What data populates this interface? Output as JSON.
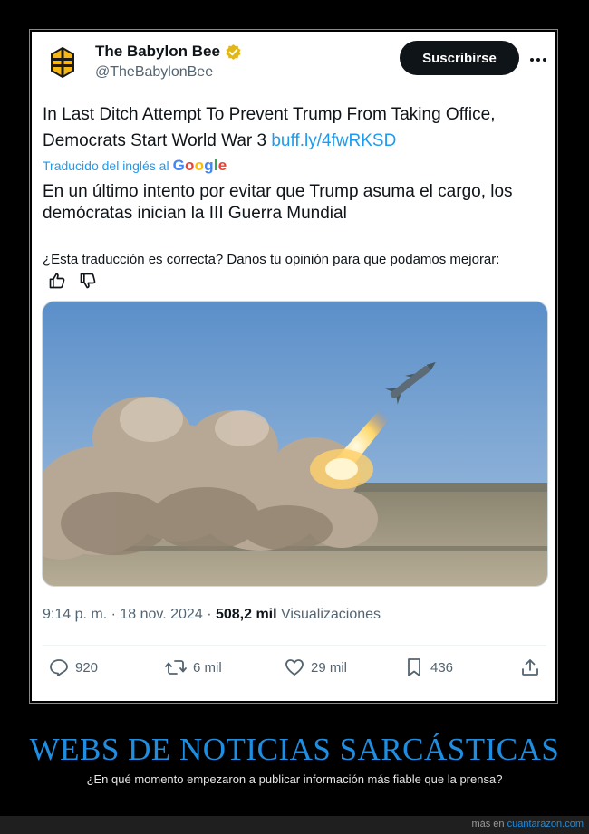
{
  "account": {
    "name": "The Babylon Bee",
    "handle": "@TheBabylonBee",
    "verified_icon": "verified-badge-gold",
    "avatar_icon": "bee-logo"
  },
  "header": {
    "subscribe_label": "Suscribirse",
    "more_icon": "more-dots"
  },
  "tweet": {
    "text": "In Last Ditch Attempt To Prevent Trump From Taking Office, Democrats Start World War 3",
    "link": "buff.ly/4fwRKSD",
    "translated_by": "Traducido del inglés al",
    "translator_brand": "Google",
    "translation": "En un último intento por evitar que Trump asuma el cargo, los demócratas inician la III Guerra Mundial",
    "feedback_question": "¿Esta traducción es correcta? Danos tu opinión para que podamos mejorar:"
  },
  "meta": {
    "time": "9:14 p. m.",
    "date": "18 nov. 2024",
    "views_count": "508,2 mil",
    "views_label": "Visualizaciones"
  },
  "actions": {
    "replies": "920",
    "reposts": "6 mil",
    "likes": "29 mil",
    "bookmarks": "436"
  },
  "banner": {
    "title": "WEBS DE NOTICIAS SARCÁSTICAS",
    "subtitle": "¿En qué momento empezaron a publicar información más fiable que la prensa?"
  },
  "footer": {
    "prefix": "más en",
    "site": "cuantarazon.com"
  },
  "colors": {
    "accent": "#1d9bf0",
    "banner": "#1f8de0",
    "verified": "#f4b400"
  }
}
